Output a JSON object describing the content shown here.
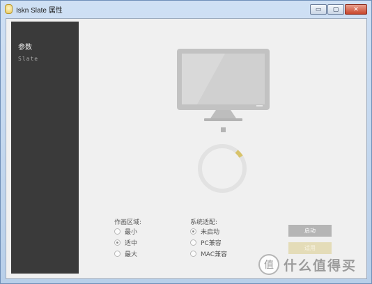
{
  "window": {
    "title": "Iskn Slate 属性",
    "minimize_glyph": "▭",
    "maximize_glyph": "▢",
    "close_glyph": "✕"
  },
  "sidebar": {
    "title": "参数",
    "items": [
      {
        "label": "Slate"
      }
    ]
  },
  "drawing_area": {
    "label": "作画区域:",
    "options": [
      {
        "label": "最小",
        "checked": false
      },
      {
        "label": "适中",
        "checked": true
      },
      {
        "label": "最大",
        "checked": false
      }
    ]
  },
  "system_adapt": {
    "label": "系统适配:",
    "options": [
      {
        "label": "未启动",
        "checked": true
      },
      {
        "label": "PC兼容",
        "checked": false
      },
      {
        "label": "MAC兼容",
        "checked": false
      }
    ]
  },
  "buttons": {
    "start": "启动",
    "apply": "适用"
  },
  "status_ring": {
    "progress": 0.05
  },
  "watermark": {
    "logo_text": "值",
    "text": "什么值得买"
  },
  "colors": {
    "sidebar_bg": "#3a3a3a",
    "ring_track": "#e2e2e2",
    "ring_progress": "#d8c36a"
  }
}
